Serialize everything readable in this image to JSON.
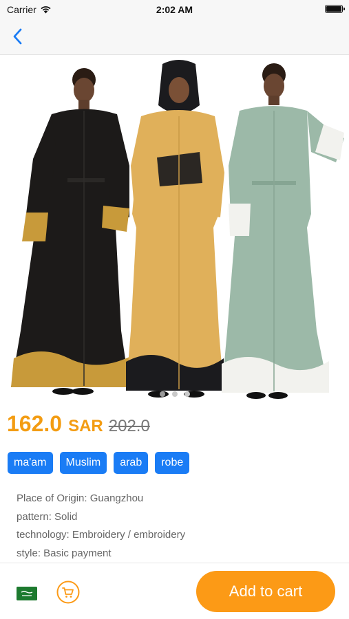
{
  "status_bar": {
    "carrier": "Carrier",
    "time": "2:02 AM"
  },
  "nav": {
    "back_icon": "chevron-left-icon"
  },
  "product": {
    "price": "162.0",
    "currency": "SAR",
    "old_price": "202.0",
    "tags": [
      "ma'am",
      "Muslim",
      "arab",
      "robe"
    ],
    "specs": [
      "Place of Origin: Guangzhou",
      "pattern: Solid",
      "technology: Embroidery / embroidery",
      "style: Basic payment"
    ],
    "image_page": 1,
    "image_count": 3
  },
  "bottom_bar": {
    "flag_icon": "saudi-flag-icon",
    "cart_icon": "shopping-cart-icon",
    "add_to_cart_label": "Add to cart"
  },
  "colors": {
    "accent": "#1a7cf5",
    "price": "#f39c12",
    "button": "#fc9a16",
    "dress_black": "#1c1a19",
    "dress_yellow": "#e0b05a",
    "dress_mint": "#9cb9a8"
  }
}
